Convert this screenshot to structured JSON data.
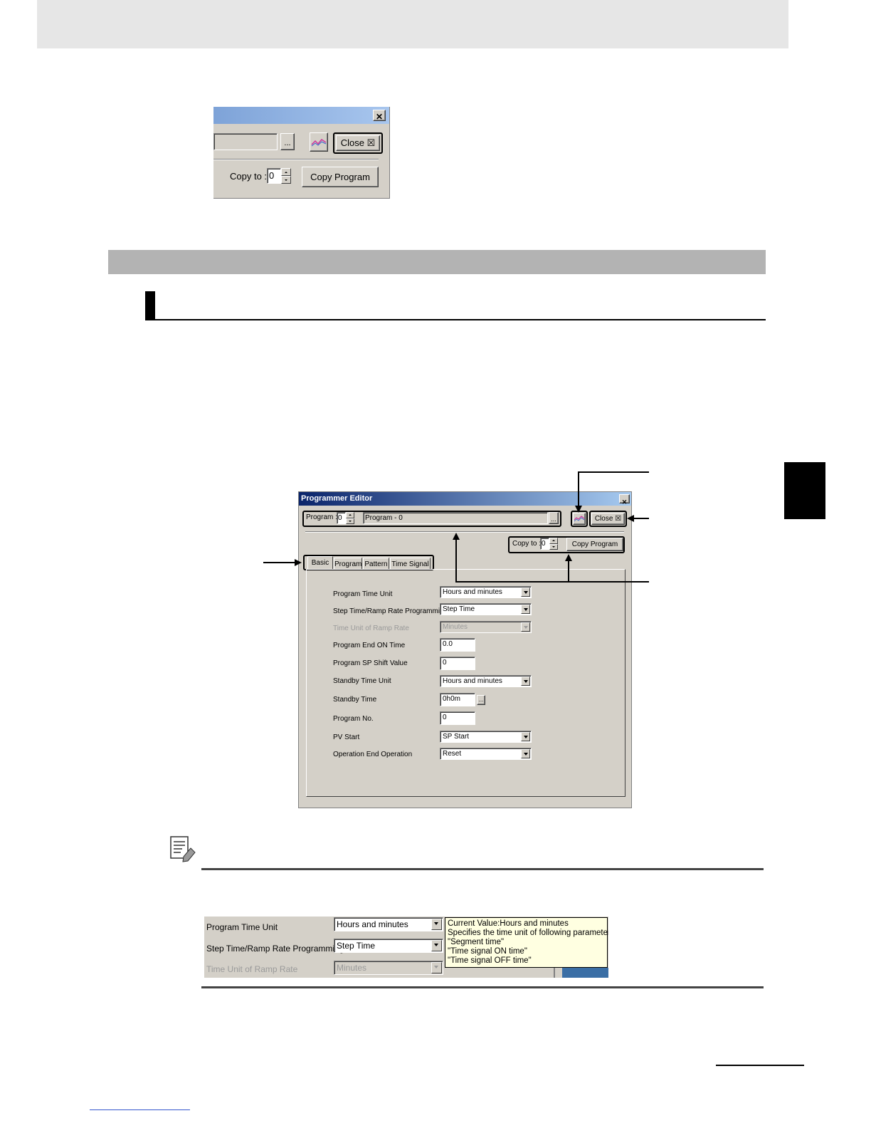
{
  "top_screenshot": {
    "browse_button": "...",
    "close_button": "Close",
    "copy_to_label": "Copy to :",
    "copy_to_value": "0",
    "copy_program_button": "Copy Program"
  },
  "editor": {
    "title": "Programmer Editor",
    "program_label": "Program :",
    "program_number": "0",
    "program_name": "Program - 0",
    "browse_button": "...",
    "close_button": "Close",
    "copy_to_label": "Copy to :",
    "copy_to_value": "0",
    "copy_program_button": "Copy Program",
    "tabs": [
      "Basic",
      "Program",
      "Pattern",
      "Time Signal"
    ],
    "params": [
      {
        "label": "Program Time Unit",
        "value": "Hours and minutes"
      },
      {
        "label": "Step Time/Ramp Rate Programming",
        "value": "Step Time"
      },
      {
        "label": "Time Unit of Ramp Rate",
        "value": "Minutes"
      },
      {
        "label": "Program End ON Time",
        "value": "0.0"
      },
      {
        "label": "Program SP Shift Value",
        "value": "0"
      },
      {
        "label": "Standby Time Unit",
        "value": "Hours and minutes"
      },
      {
        "label": "Standby Time",
        "value": "0h0m"
      },
      {
        "label": "Program No.",
        "value": "0"
      },
      {
        "label": "PV Start",
        "value": "SP Start"
      },
      {
        "label": "Operation End Operation",
        "value": "Reset"
      }
    ],
    "standby_browse": "..."
  },
  "tooltip_screenshot": {
    "params": [
      {
        "label": "Program Time Unit",
        "value": "Hours and minutes"
      },
      {
        "label": "Step Time/Ramp Rate Programming",
        "value": "Step Time"
      },
      {
        "label": "Time Unit of Ramp Rate",
        "value": "Minutes"
      }
    ],
    "tooltip_lines": [
      "Current Value:Hours and minutes",
      "Specifies the time unit of following parameters.",
      "\"Segment time\"",
      "\"Time signal ON time\"",
      "\"Time signal OFF time\""
    ]
  },
  "icons": {
    "close_glyph": "✕",
    "close_box_glyph": "☒"
  },
  "colors": {
    "titlebar_active": "#0a246a",
    "dialog_face": "#d4d0c8",
    "tooltip_bg": "#ffffe1",
    "section_bar": "#b3b3b3",
    "graph_icon_line1": "#cc3399",
    "graph_icon_line2": "#3366cc"
  }
}
